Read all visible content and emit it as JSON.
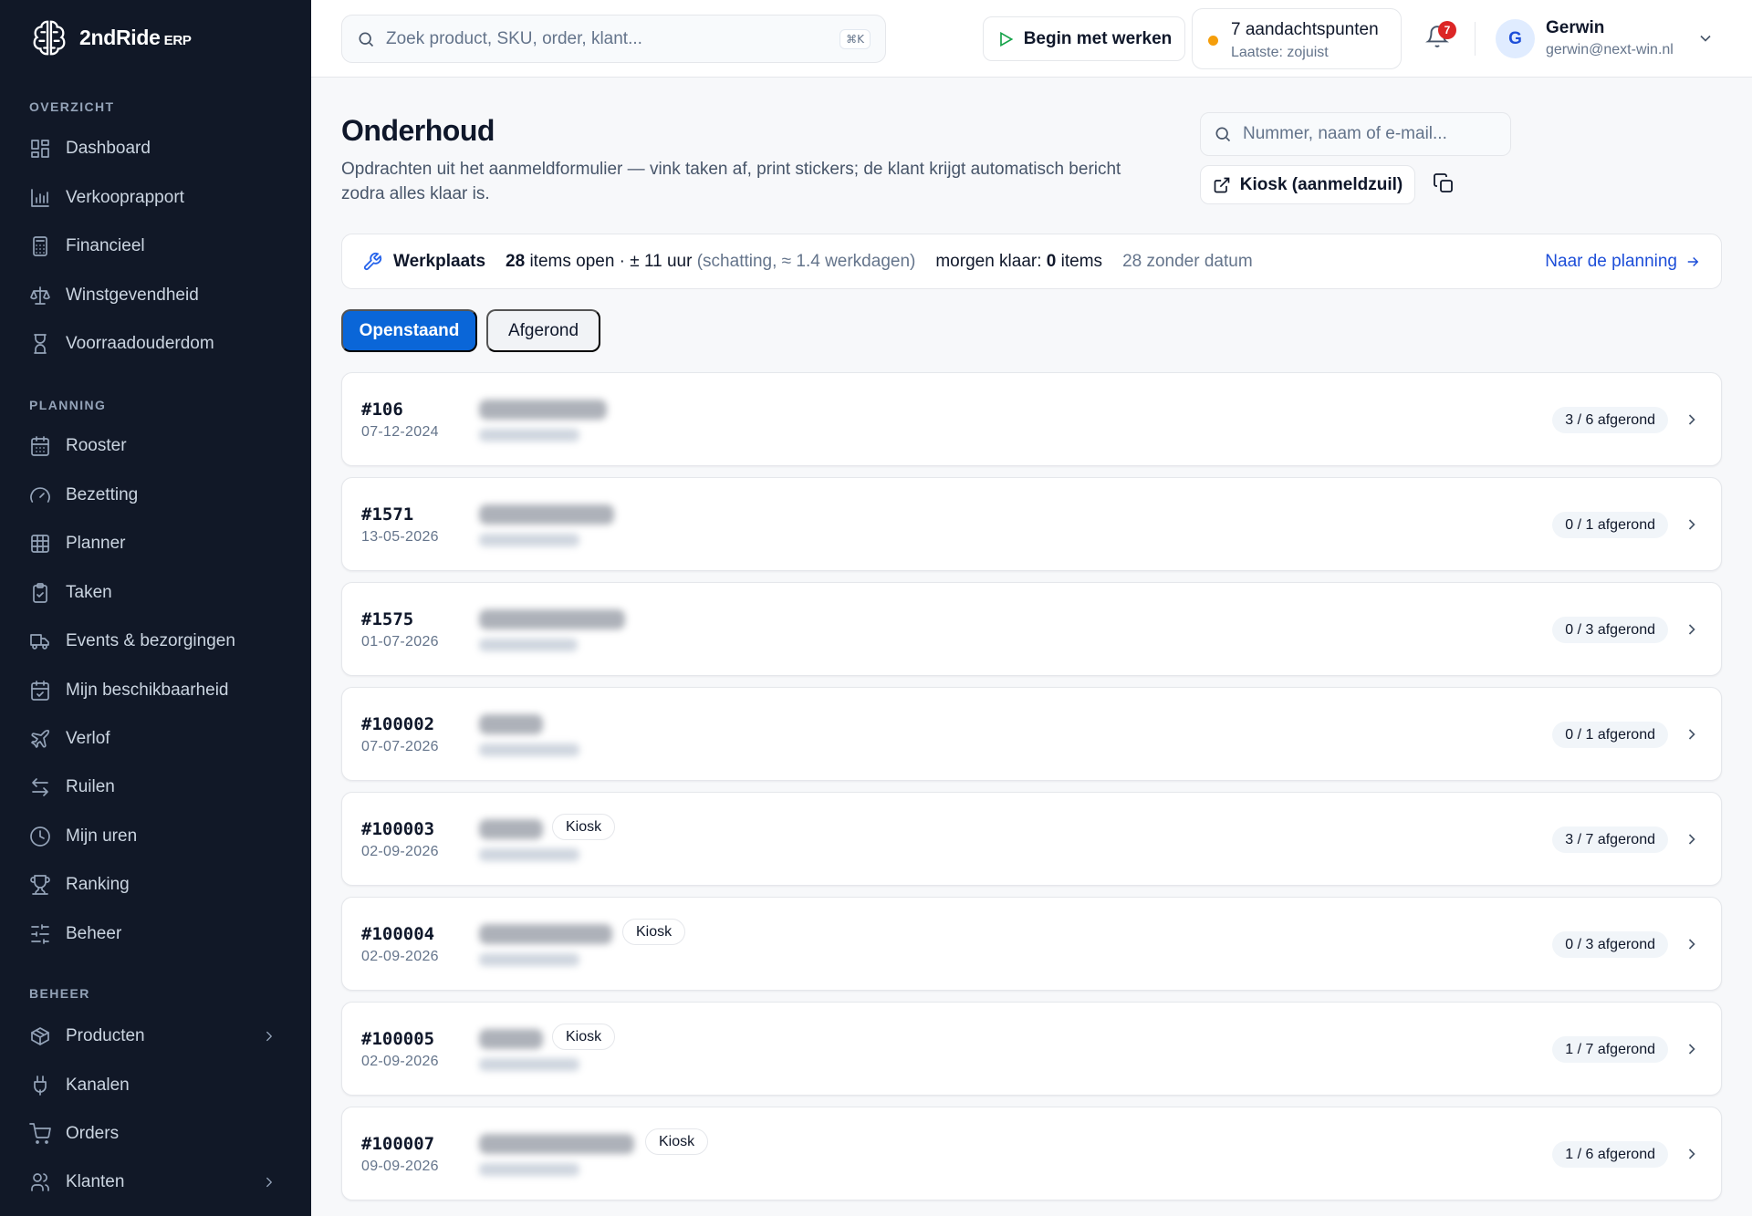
{
  "brand": {
    "name": "2ndRide",
    "suffix": "ERP"
  },
  "sidebar": {
    "sections": [
      {
        "label": "OVERZICHT"
      },
      {
        "label": "PLANNING"
      },
      {
        "label": "BEHEER"
      }
    ],
    "items": [
      {
        "label": "Dashboard",
        "icon": "dashboard-icon"
      },
      {
        "label": "Verkooprapport",
        "icon": "bar-chart-icon"
      },
      {
        "label": "Financieel",
        "icon": "calculator-icon"
      },
      {
        "label": "Winstgevendheid",
        "icon": "scale-icon"
      },
      {
        "label": "Voorraadouderdom",
        "icon": "hourglass-icon"
      },
      {
        "label": "Rooster",
        "icon": "calendar-grid-icon"
      },
      {
        "label": "Bezetting",
        "icon": "gauge-icon"
      },
      {
        "label": "Planner",
        "icon": "grid-icon"
      },
      {
        "label": "Taken",
        "icon": "clipboard-check-icon"
      },
      {
        "label": "Events & bezorgingen",
        "icon": "truck-icon"
      },
      {
        "label": "Mijn beschikbaarheid",
        "icon": "calendar-check-icon"
      },
      {
        "label": "Verlof",
        "icon": "plane-icon"
      },
      {
        "label": "Ruilen",
        "icon": "swap-icon"
      },
      {
        "label": "Mijn uren",
        "icon": "clock-icon"
      },
      {
        "label": "Ranking",
        "icon": "trophy-icon"
      },
      {
        "label": "Beheer",
        "icon": "sliders-icon"
      },
      {
        "label": "Producten",
        "icon": "package-icon"
      },
      {
        "label": "Kanalen",
        "icon": "plug-icon"
      },
      {
        "label": "Orders",
        "icon": "cart-icon"
      },
      {
        "label": "Klanten",
        "icon": "users-icon"
      }
    ]
  },
  "topbar": {
    "search_placeholder": "Zoek product, SKU, order, klant...",
    "search_shortcut": "⌘K",
    "start_label": "Begin met werken",
    "attention_title": "7 aandachtspunten",
    "attention_sub": "Laatste: zojuist",
    "notification_count": "7",
    "user_initial": "G",
    "user_name": "Gerwin",
    "user_email": "gerwin@next-win.nl"
  },
  "page": {
    "title": "Onderhoud",
    "subtitle": "Opdrachten uit het aanmeldformulier — vink taken af, print stickers; de klant krijgt automatisch bericht zodra alles klaar is.",
    "lookup_placeholder": "Nummer, naam of e-mail...",
    "kiosk_button": "Kiosk (aanmeldzuil)"
  },
  "status": {
    "workshop": "Werkplaats",
    "open_count": "28",
    "open_text": "items open · ± 11 uur",
    "estimate": "(schatting, ≈ 1.4 werkdagen)",
    "tomorrow_label": "morgen klaar:",
    "tomorrow_count": "0",
    "tomorrow_unit": "items",
    "no_date": "28 zonder datum",
    "planning_link": "Naar de planning"
  },
  "tabs": {
    "open": "Openstaand",
    "done": "Afgerond"
  },
  "orders": [
    {
      "number": "#106",
      "date": "07-12-2024",
      "kiosk": "",
      "progress": "3 / 6 afgerond"
    },
    {
      "number": "#1571",
      "date": "13-05-2026",
      "kiosk": "",
      "progress": "0 / 1 afgerond"
    },
    {
      "number": "#1575",
      "date": "01-07-2026",
      "kiosk": "",
      "progress": "0 / 3 afgerond"
    },
    {
      "number": "#100002",
      "date": "07-07-2026",
      "kiosk": "",
      "progress": "0 / 1 afgerond"
    },
    {
      "number": "#100003",
      "date": "02-09-2026",
      "kiosk": "Kiosk",
      "progress": "3 / 7 afgerond"
    },
    {
      "number": "#100004",
      "date": "02-09-2026",
      "kiosk": "Kiosk",
      "progress": "0 / 3 afgerond"
    },
    {
      "number": "#100005",
      "date": "02-09-2026",
      "kiosk": "Kiosk",
      "progress": "1 / 7 afgerond"
    },
    {
      "number": "#100007",
      "date": "09-09-2026",
      "kiosk": "Kiosk",
      "progress": "1 / 6 afgerond"
    }
  ],
  "colors": {
    "sidebar": "#111827",
    "accent": "#0a66d8",
    "attention_dot": "#f59e0b",
    "badge": "#dc2626"
  }
}
